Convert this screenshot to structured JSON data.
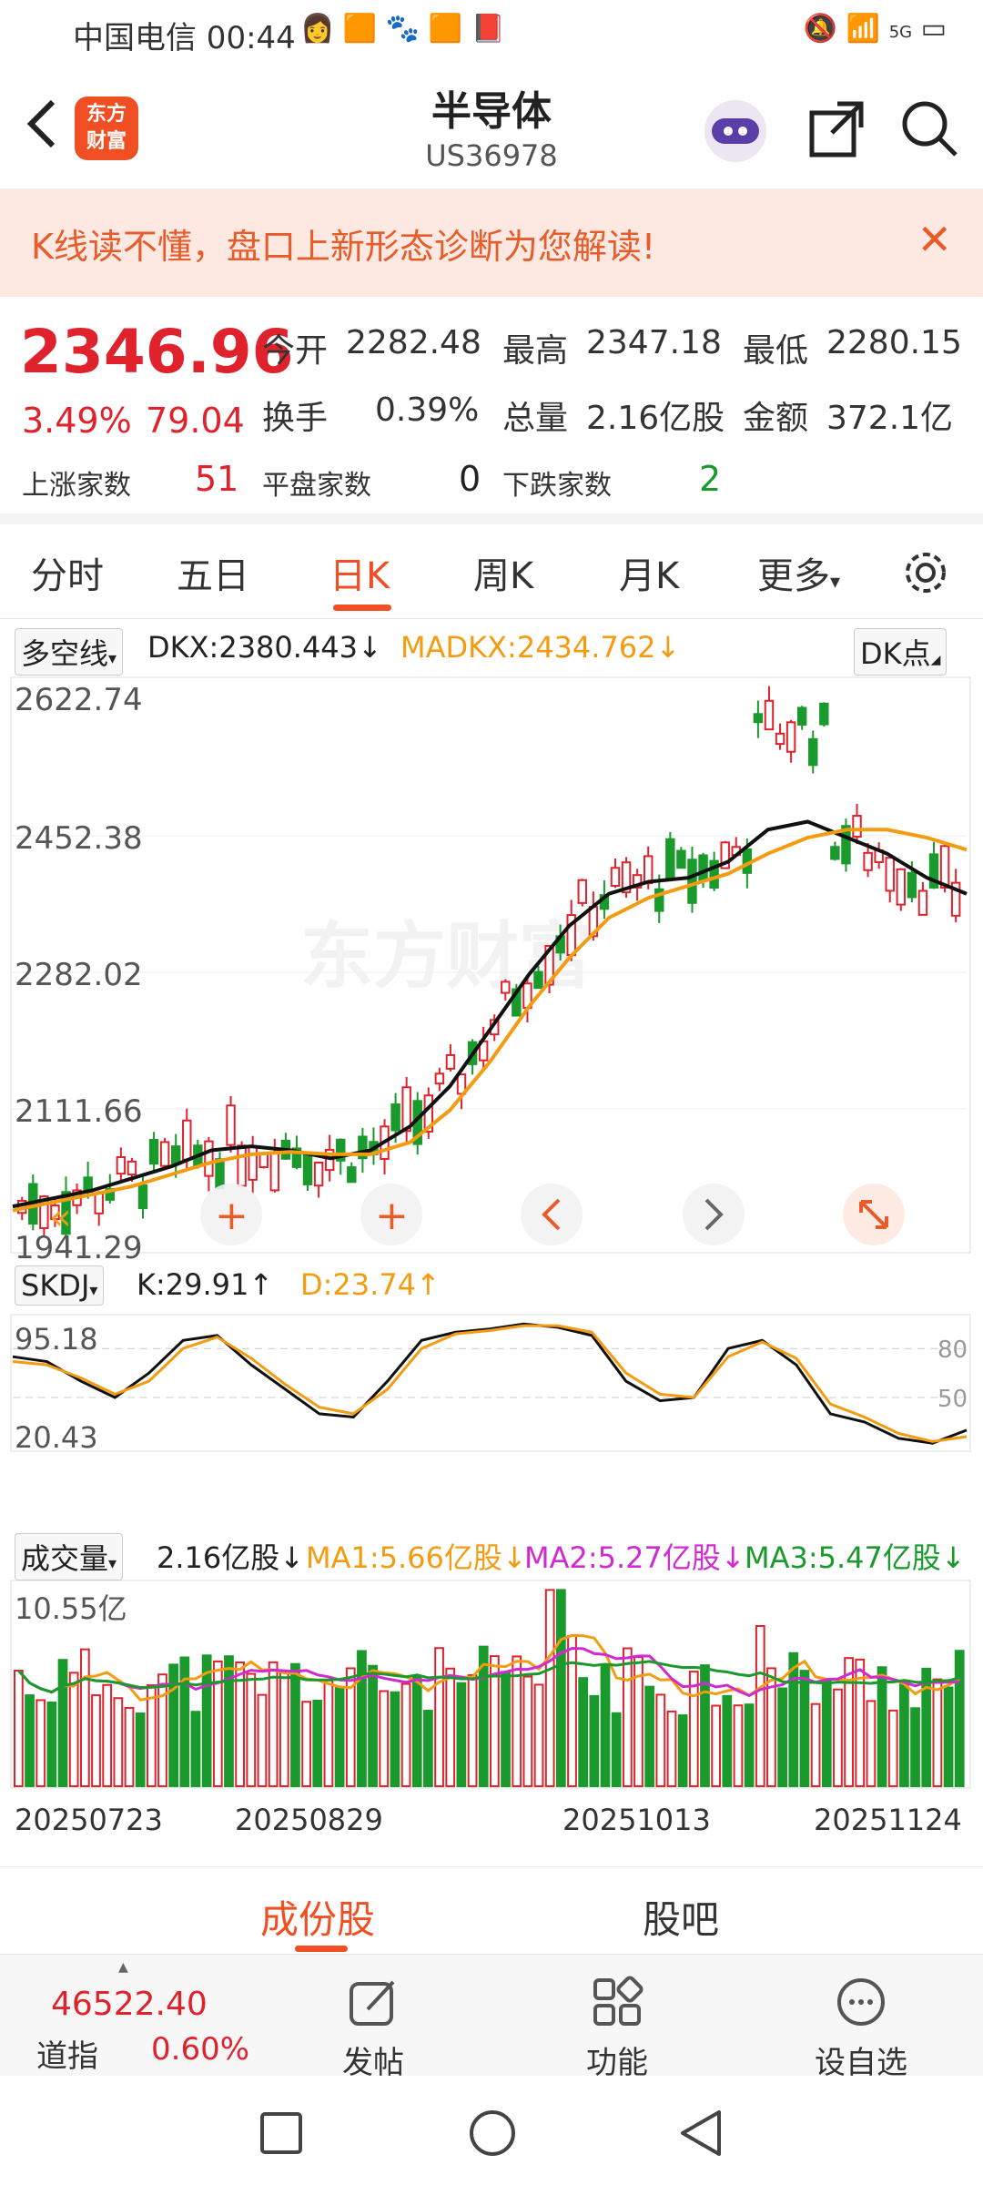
{
  "status_bar": {
    "carrier_time": "中国电信 00:44",
    "signal": "5G"
  },
  "header": {
    "logo_line1": "东方",
    "logo_line2": "财富",
    "title": "半导体",
    "code": "US36978"
  },
  "banner": {
    "text": "K线读不懂，盘口上新形态诊断为您解读!",
    "close": "✕"
  },
  "quote": {
    "price": "2346.96",
    "change_pct": "3.49%",
    "change": "79.04",
    "open_label": "今开",
    "open": "2282.48",
    "high_label": "最高",
    "high": "2347.18",
    "low_label": "最低",
    "low": "2280.15",
    "turnover_label": "换手",
    "turnover": "0.39%",
    "volume_label": "总量",
    "volume": "2.16亿股",
    "amount_label": "金额",
    "amount": "372.1亿",
    "up_label": "上涨家数",
    "up": "51",
    "flat_label": "平盘家数",
    "flat": "0",
    "down_label": "下跌家数",
    "down": "2"
  },
  "tabs": [
    "分时",
    "五日",
    "日K",
    "周K",
    "月K",
    "更多"
  ],
  "active_tab": "日K",
  "indicator_main": {
    "selector": "多空线",
    "dkx": "DKX:2380.443↓",
    "madkx": "MADKX:2434.762↓",
    "dk_button": "DK点"
  },
  "indicator_skdj": {
    "selector": "SKDJ",
    "k": "K:29.91↑",
    "d": "D:23.74↑"
  },
  "indicator_vol": {
    "selector": "成交量",
    "vol": "2.16亿股↓",
    "ma1": "MA1:5.66亿股↓",
    "ma2": "MA2:5.27亿股↓",
    "ma3": "MA3:5.47亿股↓"
  },
  "chart_data": [
    {
      "type": "candlestick",
      "y_ticks": [
        "2622.74",
        "2452.38",
        "2282.02",
        "2111.66",
        "1941.29"
      ],
      "ylim": [
        1941.29,
        2622.74
      ],
      "watermark": "东方财富",
      "series": [
        {
          "name": "DKX",
          "color": "#111111",
          "values": [
            1990,
            2000,
            2010,
            2025,
            2040,
            2060,
            2065,
            2060,
            2050,
            2060,
            2090,
            2140,
            2210,
            2280,
            2340,
            2380,
            2395,
            2400,
            2420,
            2460,
            2470,
            2450,
            2430,
            2400,
            2380
          ]
        },
        {
          "name": "MADKX",
          "color": "#f39c12",
          "values": [
            1985,
            1995,
            2005,
            2015,
            2030,
            2045,
            2055,
            2058,
            2055,
            2055,
            2070,
            2110,
            2170,
            2240,
            2300,
            2350,
            2375,
            2390,
            2405,
            2430,
            2450,
            2460,
            2460,
            2450,
            2435
          ]
        }
      ]
    },
    {
      "type": "line",
      "y_ticks": [
        "95.18",
        "20.43"
      ],
      "ref_labels": [
        "80",
        "50"
      ],
      "series": [
        {
          "name": "K",
          "color": "#111111",
          "values": [
            75,
            72,
            60,
            50,
            65,
            85,
            88,
            70,
            55,
            40,
            38,
            60,
            85,
            90,
            92,
            95,
            93,
            88,
            60,
            48,
            50,
            80,
            85,
            70,
            40,
            35,
            25,
            22,
            30
          ]
        },
        {
          "name": "D",
          "color": "#f39c12",
          "values": [
            72,
            70,
            62,
            52,
            60,
            80,
            87,
            74,
            58,
            44,
            40,
            55,
            80,
            89,
            91,
            94,
            94,
            90,
            65,
            52,
            50,
            75,
            84,
            74,
            46,
            38,
            28,
            23,
            26
          ]
        }
      ]
    },
    {
      "type": "bar",
      "y_ticks": [
        "10.55亿"
      ],
      "x_ticks": [
        "20250723",
        "20250829",
        "20251013",
        "20251124"
      ],
      "series": [
        {
          "name": "MA1",
          "color": "#f39c12"
        },
        {
          "name": "MA2",
          "color": "#d12ad1"
        },
        {
          "name": "MA3",
          "color": "#1a9a2c"
        }
      ]
    }
  ],
  "subtabs": [
    "成份股",
    "股吧"
  ],
  "active_subtab": "成份股",
  "bottom": {
    "index_value": "46522.40",
    "index_name": "道指",
    "index_pct": "0.60%",
    "post": "发帖",
    "functions": "功能",
    "set_fav": "设自选"
  }
}
